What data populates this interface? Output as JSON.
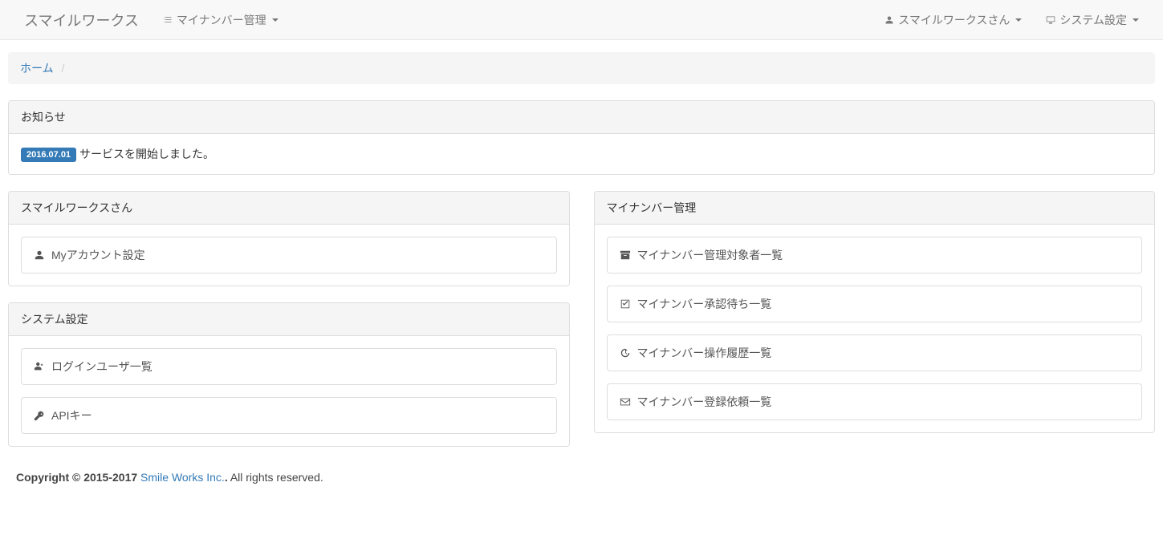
{
  "navbar": {
    "brand": "スマイルワークス",
    "menu_mynumber": "マイナンバー管理",
    "user_label": "スマイルワークスさん",
    "system_settings": "システム設定"
  },
  "breadcrumb": {
    "home": "ホーム"
  },
  "notice_panel": {
    "title": "お知らせ",
    "date_badge": "2016.07.01",
    "message": "サービスを開始しました。"
  },
  "account_panel": {
    "title": "スマイルワークスさん",
    "item_myaccount": "Myアカウント設定"
  },
  "system_panel": {
    "title": "システム設定",
    "item_login_users": "ログインユーザ一覧",
    "item_api_key": "APIキー"
  },
  "mynumber_panel": {
    "title": "マイナンバー管理",
    "item_targets": "マイナンバー管理対象者一覧",
    "item_pending": "マイナンバー承認待ち一覧",
    "item_history": "マイナンバー操作履歴一覧",
    "item_requests": "マイナンバー登録依頼一覧"
  },
  "footer": {
    "copyright_prefix": "Copyright © 2015-2017 ",
    "company": "Smile Works Inc.",
    "suffix": " All rights reserved."
  }
}
